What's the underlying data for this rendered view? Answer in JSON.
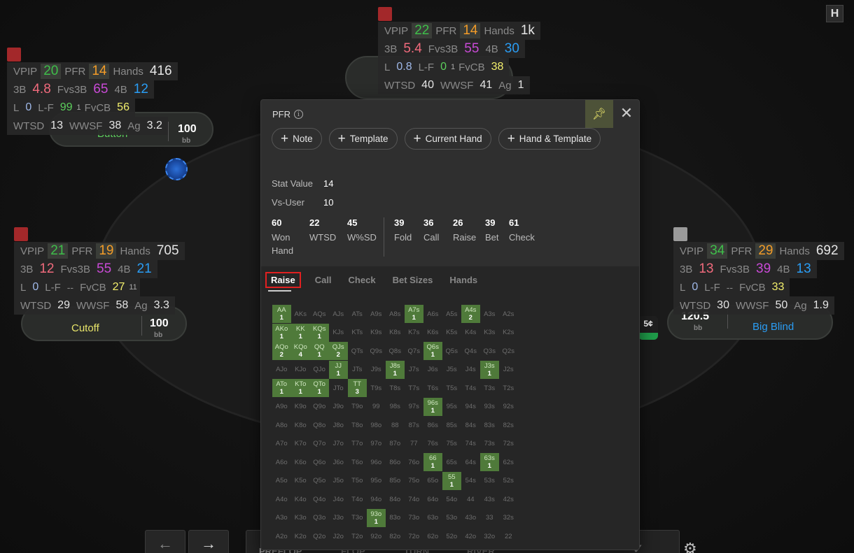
{
  "huds": {
    "top": {
      "vpip": "22",
      "pfr": "14",
      "hands": "1k",
      "b3": "5.4",
      "fvs3b": "55",
      "b4": "30",
      "l": "0.8",
      "lf": "0",
      "lf_sub": "1",
      "fvcb": "38",
      "wtsd": "40",
      "wwsf": "41",
      "ag": "1"
    },
    "button": {
      "vpip": "20",
      "pfr": "14",
      "hands": "416",
      "b3": "4.8",
      "fvs3b": "65",
      "b4": "12",
      "l": "0",
      "lf": "99",
      "lf_sub": "1",
      "fvcb": "56",
      "wtsd": "13",
      "wwsf": "38",
      "ag": "3.2"
    },
    "cutoff": {
      "vpip": "21",
      "pfr": "19",
      "hands": "705",
      "b3": "12",
      "fvs3b": "55",
      "b4": "21",
      "l": "0",
      "lf": "--",
      "fvcb": "27",
      "fvcb_sub": "11",
      "wtsd": "29",
      "wwsf": "58",
      "ag": "3.3"
    },
    "bigblind": {
      "vpip": "34",
      "pfr": "29",
      "hands": "692",
      "b3": "13",
      "fvs3b": "39",
      "b4": "13",
      "l": "0",
      "lf": "--",
      "fvcb": "33",
      "wtsd": "30",
      "wwsf": "50",
      "ag": "1.9"
    }
  },
  "labels": {
    "vpip": "VPIP",
    "pfr": "PFR",
    "hands": "Hands",
    "b3": "3B",
    "fvs3b": "Fvs3B",
    "b4": "4B",
    "l": "L",
    "lf": "L-F",
    "fvcb": "FvCB",
    "wtsd": "WTSD",
    "wwsf": "WWSF",
    "ag": "Ag"
  },
  "seats": {
    "button": {
      "name": "Button",
      "stack": "100",
      "unit": "bb"
    },
    "cutoff": {
      "name": "Cutoff",
      "stack": "100",
      "unit": "bb"
    },
    "bigblind": {
      "name": "Big Blind",
      "stack": "120.5",
      "unit": "bb"
    }
  },
  "chip_label": "5¢",
  "popup": {
    "title": "PFR",
    "actions": [
      "Note",
      "Template",
      "Current Hand",
      "Hand & Template"
    ],
    "stat_value_label": "Stat Value",
    "stat_value": "14",
    "vs_user_label": "Vs-User",
    "vs_user": "10",
    "metrics_a": [
      {
        "n": "60",
        "l": "Won Hand"
      },
      {
        "n": "22",
        "l": "WTSD"
      },
      {
        "n": "45",
        "l": "W%SD"
      }
    ],
    "metrics_b": [
      {
        "n": "39",
        "l": "Fold"
      },
      {
        "n": "36",
        "l": "Call"
      },
      {
        "n": "26",
        "l": "Raise"
      },
      {
        "n": "39",
        "l": "Bet"
      },
      {
        "n": "61",
        "l": "Check"
      }
    ],
    "tabs": [
      "Raise",
      "Call",
      "Check",
      "Bet Sizes",
      "Hands"
    ],
    "active_tab": "Raise",
    "hand_grid": [
      [
        "AA",
        "AKs",
        "AQs",
        "AJs",
        "ATs",
        "A9s",
        "A8s",
        "A7s",
        "A6s",
        "A5s",
        "A4s",
        "A3s",
        "A2s"
      ],
      [
        "AKo",
        "KK",
        "KQs",
        "KJs",
        "KTs",
        "K9s",
        "K8s",
        "K7s",
        "K6s",
        "K5s",
        "K4s",
        "K3s",
        "K2s"
      ],
      [
        "AQo",
        "KQo",
        "QQ",
        "QJs",
        "QTs",
        "Q9s",
        "Q8s",
        "Q7s",
        "Q6s",
        "Q5s",
        "Q4s",
        "Q3s",
        "Q2s"
      ],
      [
        "AJo",
        "KJo",
        "QJo",
        "JJ",
        "JTs",
        "J9s",
        "J8s",
        "J7s",
        "J6s",
        "J5s",
        "J4s",
        "J3s",
        "J2s"
      ],
      [
        "ATo",
        "KTo",
        "QTo",
        "JTo",
        "TT",
        "T9s",
        "T8s",
        "T7s",
        "T6s",
        "T5s",
        "T4s",
        "T3s",
        "T2s"
      ],
      [
        "A9o",
        "K9o",
        "Q9o",
        "J9o",
        "T9o",
        "99",
        "98s",
        "97s",
        "96s",
        "95s",
        "94s",
        "93s",
        "92s"
      ],
      [
        "A8o",
        "K8o",
        "Q8o",
        "J8o",
        "T8o",
        "98o",
        "88",
        "87s",
        "86s",
        "85s",
        "84s",
        "83s",
        "82s"
      ],
      [
        "A7o",
        "K7o",
        "Q7o",
        "J7o",
        "T7o",
        "97o",
        "87o",
        "77",
        "76s",
        "75s",
        "74s",
        "73s",
        "72s"
      ],
      [
        "A6o",
        "K6o",
        "Q6o",
        "J6o",
        "T6o",
        "96o",
        "86o",
        "76o",
        "66",
        "65s",
        "64s",
        "63s",
        "62s"
      ],
      [
        "A5o",
        "K5o",
        "Q5o",
        "J5o",
        "T5o",
        "95o",
        "85o",
        "75o",
        "65o",
        "55",
        "54s",
        "53s",
        "52s"
      ],
      [
        "A4o",
        "K4o",
        "Q4o",
        "J4o",
        "T4o",
        "94o",
        "84o",
        "74o",
        "64o",
        "54o",
        "44",
        "43s",
        "42s"
      ],
      [
        "A3o",
        "K3o",
        "Q3o",
        "J3o",
        "T3o",
        "93o",
        "83o",
        "73o",
        "63o",
        "53o",
        "43o",
        "33",
        "32s"
      ],
      [
        "A2o",
        "K2o",
        "Q2o",
        "J2o",
        "T2o",
        "92o",
        "82o",
        "72o",
        "62o",
        "52o",
        "42o",
        "32o",
        "22"
      ]
    ],
    "hand_counts": {
      "AA": "1",
      "A7s": "1",
      "A4s": "2",
      "AKo": "1",
      "KK": "1",
      "KQs": "1",
      "AQo": "2",
      "KQo": "4",
      "QQ": "1",
      "QJs": "2",
      "Q6s": "1",
      "JJ": "1",
      "J8s": "1",
      "J3s": "1",
      "ATo": "1",
      "KTo": "1",
      "QTo": "1",
      "TT": "3",
      "96s": "1",
      "66": "1",
      "63s": "1",
      "55": "1",
      "93o": "1"
    }
  },
  "bottom": {
    "back": "←",
    "forward": "→",
    "streets": [
      "PREFLOP",
      "FLOP",
      "TURN",
      "RIVER"
    ],
    "check": "✓"
  },
  "logo": "H",
  "colors": {
    "tag_red": "#a3282a",
    "tag_grey": "#9a9a9a",
    "hit_cell": "#4f7a3a",
    "pin_bg": "#4d5238",
    "active_tab_border": "#e12020"
  }
}
